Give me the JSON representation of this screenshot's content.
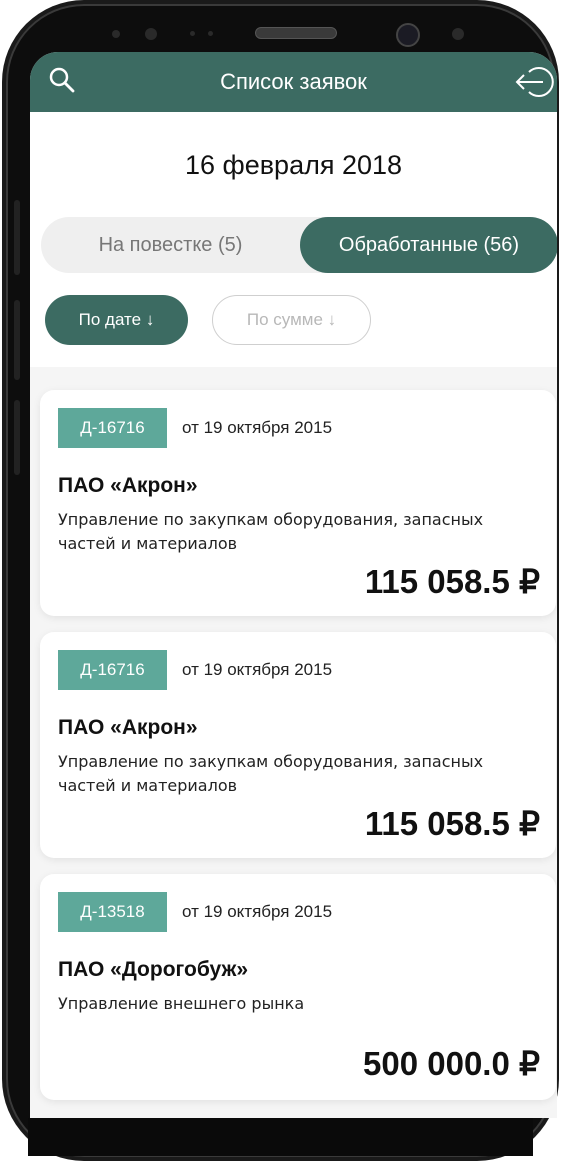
{
  "header": {
    "title": "Список заявок",
    "left_icon": "search-icon",
    "right_icon": "logout-icon",
    "color": "#3c6b62"
  },
  "date_title": "16 февраля 2018",
  "tabs": [
    {
      "label": "На повестке (5)",
      "active": false
    },
    {
      "label": "Обработанные (56)",
      "active": true
    }
  ],
  "sort": {
    "by_date": "По дате ↓",
    "by_sum": "По сумме ↓",
    "active": "by_date"
  },
  "requests": [
    {
      "code": "Д-16716",
      "date": "от 19 октября 2015",
      "company": "ПАО «Акрон»",
      "department": "Управление по закупкам оборудования, запасных частей и материалов",
      "amount": "115 058.5 ₽"
    },
    {
      "code": "Д-16716",
      "date": "от 19 октября 2015",
      "company": "ПАО «Акрон»",
      "department": "Управление по закупкам оборудования, запасных частей и материалов",
      "amount": "115 058.5 ₽"
    },
    {
      "code": "Д-13518",
      "date": "от 19 октября 2015",
      "company": "ПАО «Дорогобуж»",
      "department": "Управление внешнего рынка",
      "amount": "500 000.0 ₽"
    }
  ],
  "colors": {
    "accent": "#3c6b62",
    "badge": "#5ea89a"
  }
}
